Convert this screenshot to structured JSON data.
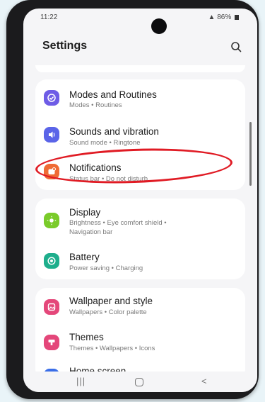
{
  "status_bar": {
    "time": "11:22",
    "signal_battery": "86%"
  },
  "header": {
    "title": "Settings"
  },
  "groups": [
    {
      "items": [
        {
          "label": "Modes and Routines",
          "sub": "Modes  •  Routines",
          "icon": "check-circle-icon",
          "color": "#6e5ce6"
        },
        {
          "label": "Sounds and vibration",
          "sub": "Sound mode  •  Ringtone",
          "icon": "speaker-icon",
          "color": "#5a64e8"
        },
        {
          "label": "Notifications",
          "sub": "Status bar  •  Do not disturb",
          "icon": "notification-icon",
          "color": "#ef6b35"
        }
      ]
    },
    {
      "items": [
        {
          "label": "Display",
          "sub": "Brightness  •  Eye comfort shield  •",
          "sub2": "Navigation bar",
          "icon": "sun-icon",
          "color": "#7acb2a"
        },
        {
          "label": "Battery",
          "sub": "Power saving  •  Charging",
          "icon": "battery-icon",
          "color": "#1eae8c"
        }
      ]
    },
    {
      "items": [
        {
          "label": "Wallpaper and style",
          "sub": "Wallpapers  •  Color palette",
          "icon": "image-icon",
          "color": "#e4477a"
        },
        {
          "label": "Themes",
          "sub": "Themes  •  Wallpapers  •  Icons",
          "icon": "themes-icon",
          "color": "#e4477a"
        },
        {
          "label": "Home screen",
          "sub": "",
          "icon": "home-icon",
          "color": "#3a6ee8"
        }
      ]
    }
  ],
  "colors": {
    "annotation": "#e01b24",
    "background": "#f5f5f7"
  }
}
